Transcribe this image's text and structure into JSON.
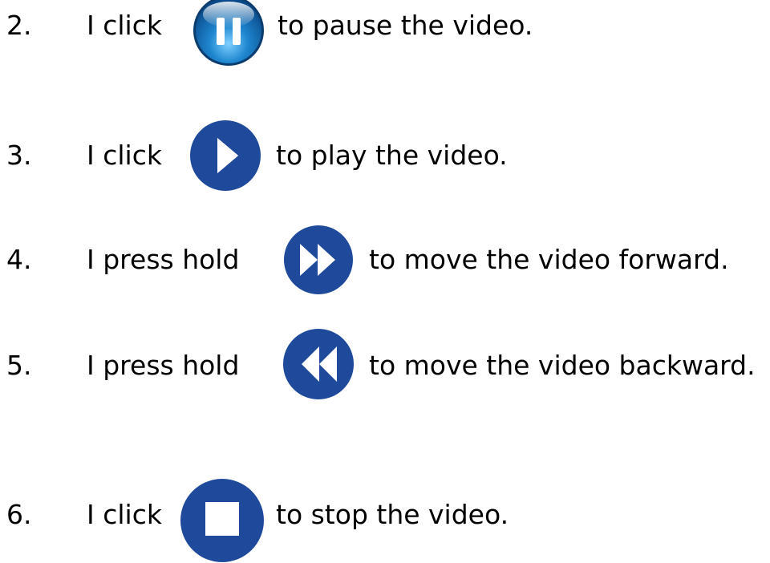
{
  "steps": [
    {
      "number": "2.",
      "lead": "I click",
      "icon": "pause-icon",
      "tail": "to pause the video."
    },
    {
      "number": "3.",
      "lead": "I click",
      "icon": "play-icon",
      "tail": "to play the video."
    },
    {
      "number": "4.",
      "lead": "I press hold",
      "icon": "fast-forward-icon",
      "tail": "to move the video forward."
    },
    {
      "number": "5.",
      "lead": "I press hold",
      "icon": "rewind-icon",
      "tail": "to move the video backward."
    },
    {
      "number": "6.",
      "lead": "I click",
      "icon": "stop-icon",
      "tail": "to stop the video."
    }
  ],
  "colors": {
    "button_blue": "#1f4a9b",
    "glossy_blue": "#1e86cf",
    "icon_white": "#ffffff",
    "text": "#000000"
  }
}
